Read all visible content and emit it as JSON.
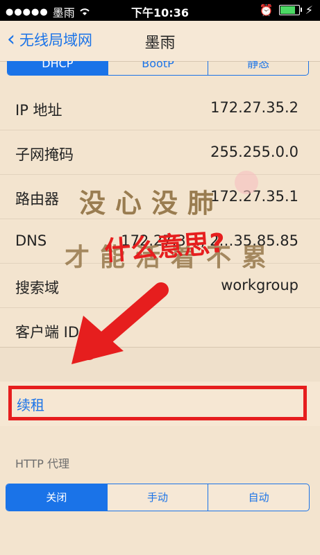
{
  "status_bar": {
    "carrier": "墨雨",
    "time": "下午10:36"
  },
  "nav": {
    "back_label": "无线局域网",
    "title": "墨雨"
  },
  "top_segment": [
    "DHCP",
    "BootP",
    "静态"
  ],
  "rows": [
    {
      "label": "IP 地址",
      "value": "172.27.35.2"
    },
    {
      "label": "子网掩码",
      "value": "255.255.0.0"
    },
    {
      "label": "路由器",
      "value": "172.27.35.1"
    },
    {
      "label": "DNS",
      "value": "172.27.3…, 2…35.85.85"
    },
    {
      "label": "搜索域",
      "value": "workgroup"
    },
    {
      "label": "客户端 ID",
      "value": ""
    }
  ],
  "renew_label": "续租",
  "http_proxy_header": "HTTP 代理",
  "proxy_segment": [
    "关闭",
    "手动",
    "自动"
  ],
  "overlay_text": {
    "line1": "没心没肺",
    "line2": "才能活着不累",
    "question": "什么意思?"
  },
  "colors": {
    "accent": "#1a73e8",
    "highlight": "#e61e1e",
    "background": "#f3e4cf"
  }
}
